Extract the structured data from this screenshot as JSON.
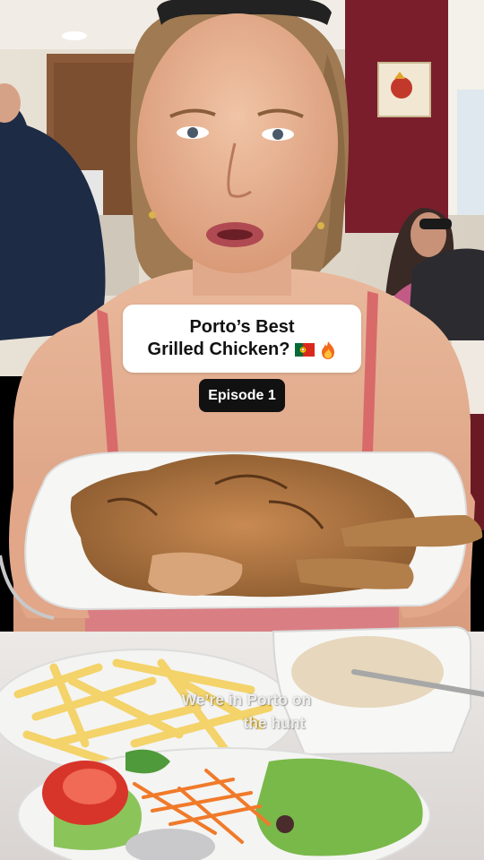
{
  "title_card": {
    "line1": "Porto’s Best",
    "line2": "Grilled Chicken?"
  },
  "episode_badge": "Episode 1",
  "caption": {
    "line1": "We’re in Porto on",
    "line2": "the hunt"
  },
  "icons": [
    "portugal-flag-icon",
    "fire-icon"
  ],
  "colors": {
    "card_background": "#ffffff",
    "badge_background": "#111111",
    "wall_red": "#7a1e2c",
    "plate_white": "#f4f4f2"
  }
}
